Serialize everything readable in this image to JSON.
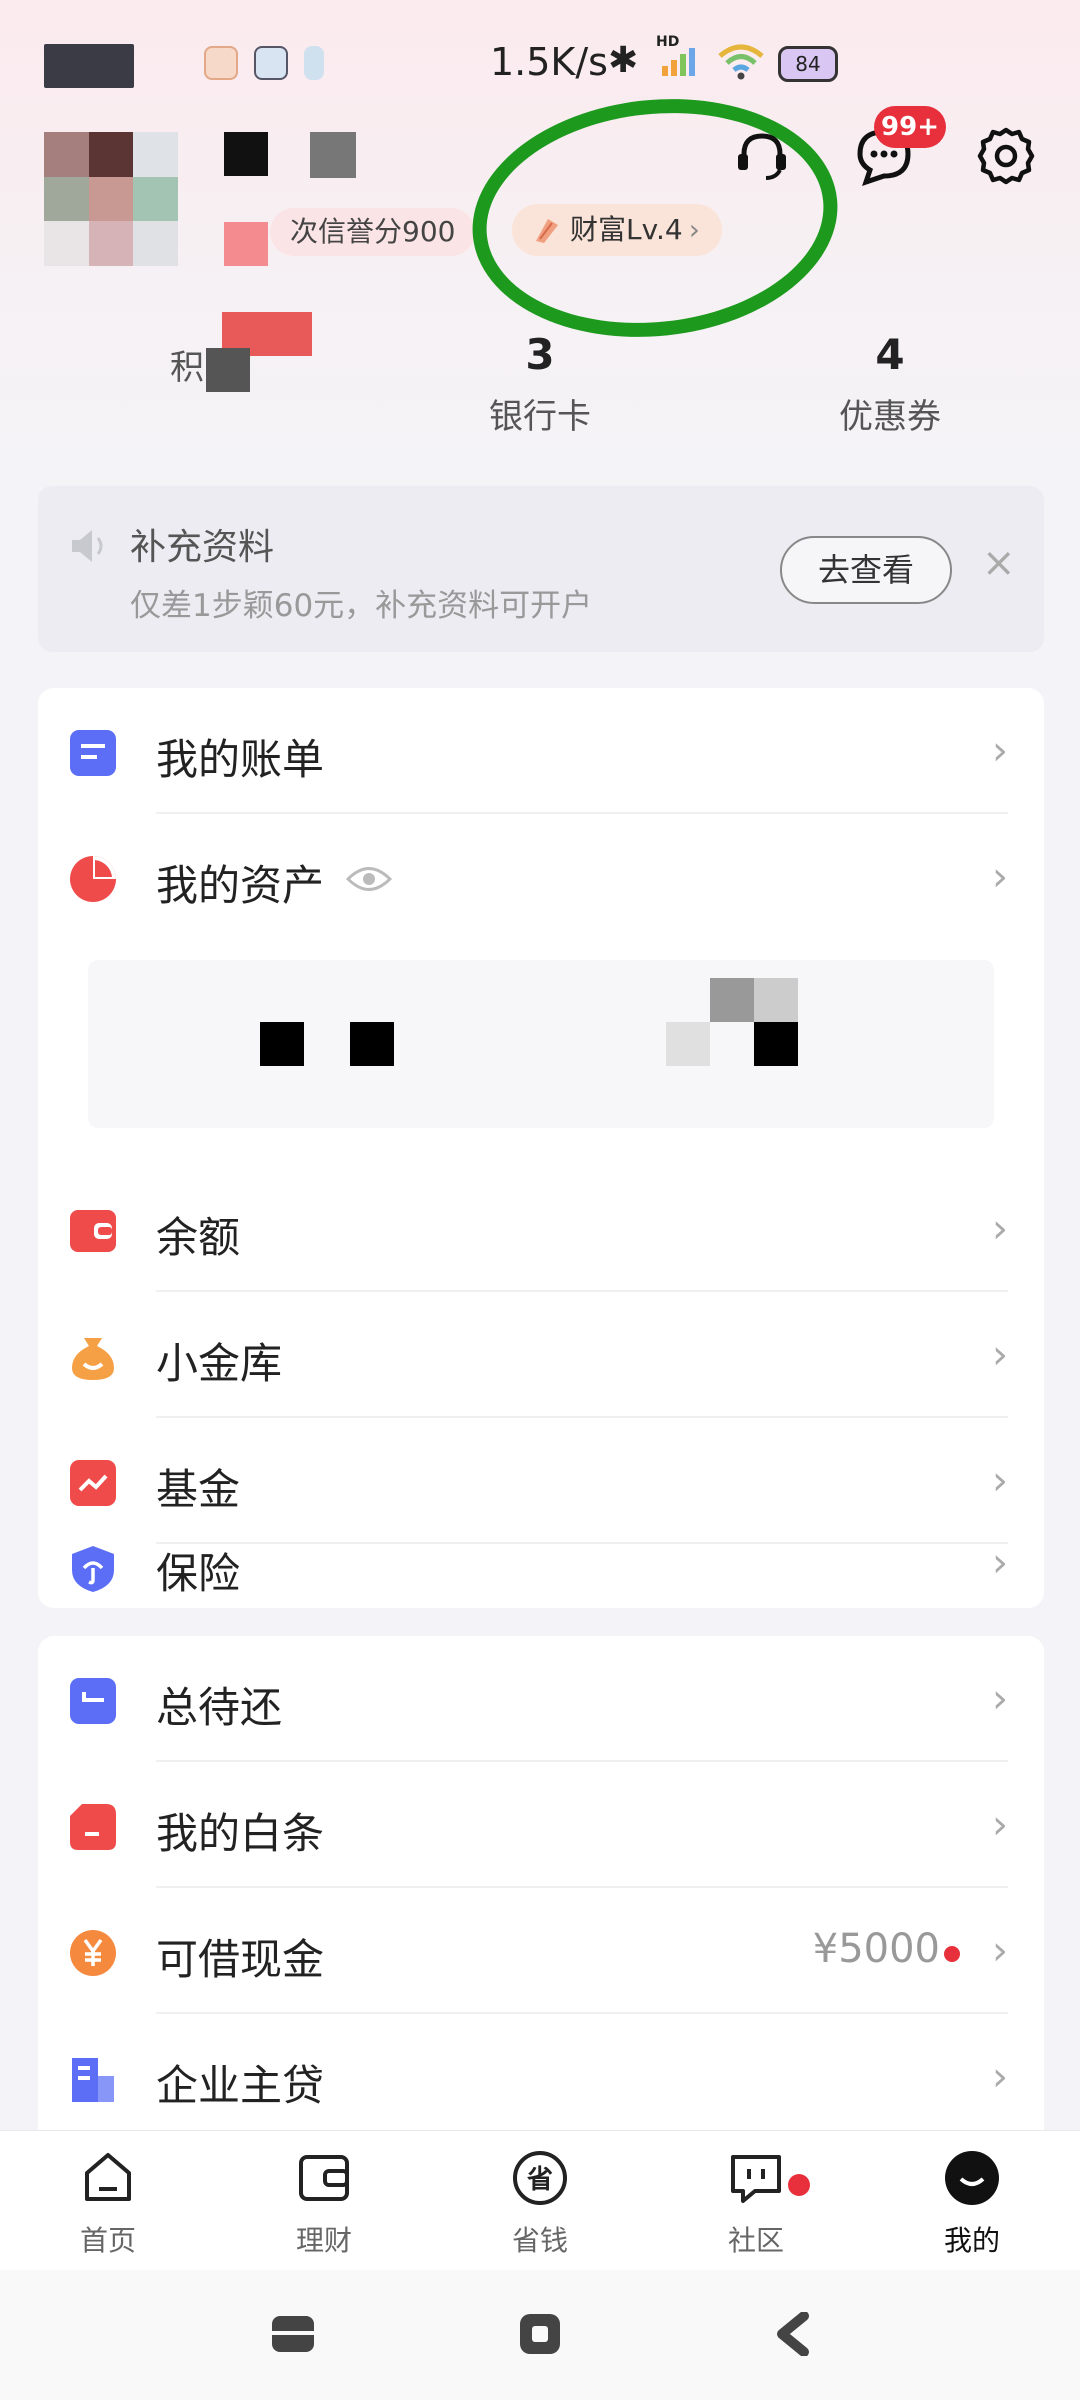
{
  "status_bar": {
    "net_speed": "1.5K/s",
    "hd": "HD",
    "battery": "84"
  },
  "profile": {
    "credit_label": "次信誉分900",
    "wealth_label": "财富Lv.4",
    "message_badge": "99+"
  },
  "stats": [
    {
      "num": "",
      "label": "积"
    },
    {
      "num": "3",
      "label": "银行卡"
    },
    {
      "num": "4",
      "label": "优惠券"
    }
  ],
  "tip": {
    "title": "补充资料",
    "subtitle": "仅差1步颖60元，补充资料可开户",
    "button": "去查看",
    "close": "×"
  },
  "card1": {
    "bill": "我的账单",
    "assets": "我的资产",
    "balance": "余额",
    "vault": "小金库",
    "fund": "基金",
    "insurance": "保险"
  },
  "card2": {
    "repay": "总待还",
    "baitiao": "我的白条",
    "cash": "可借现金",
    "cash_value": "¥5000",
    "business": "企业主贷"
  },
  "tabs": {
    "home": "首页",
    "finance": "理财",
    "save": "省钱",
    "community": "社区",
    "mine": "我的"
  },
  "chevron": "›",
  "colors": {
    "accent_red": "#e8303c",
    "circle_green": "#1d9a1d",
    "icon_blue": "#5b6ef5"
  }
}
